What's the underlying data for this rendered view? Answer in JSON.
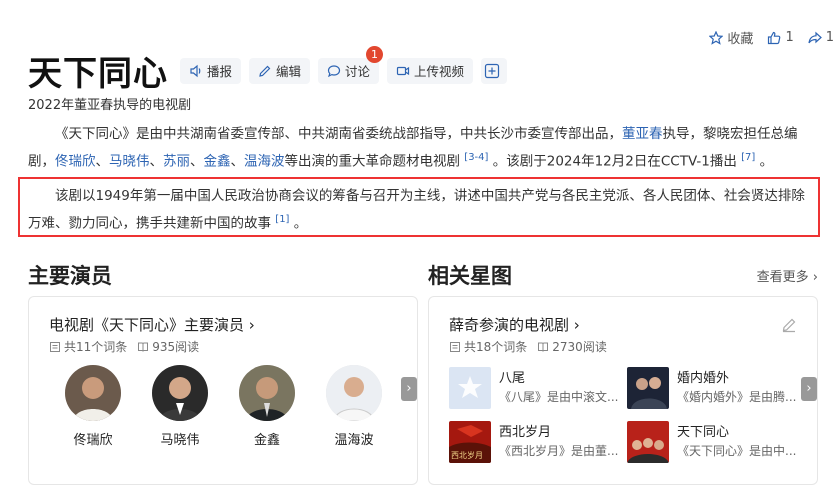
{
  "top_actions": {
    "collect_label": "收藏",
    "like_count": "1",
    "share_count": "1"
  },
  "title": "天下同心",
  "toolbar": {
    "report": "播报",
    "edit": "编辑",
    "discuss": "讨论",
    "discuss_badge": "1",
    "upload": "上传视频",
    "add": "+"
  },
  "subtitle": "2022年董亚春执导的电视剧",
  "para1": {
    "t1": "《天下同心》是由中共湖南省委宣传部、中共湖南省委统战部指导，中共长沙市委宣传部出品，",
    "l1": "董亚春",
    "t2": "执导，黎晓宏担任总编剧，",
    "a1": "佟瑞欣",
    "s1": "、",
    "a2": "马晓伟",
    "s2": "、",
    "a3": "苏丽",
    "s3": "、",
    "a4": "金鑫",
    "s4": "、",
    "a5": "温海波",
    "t3": "等出演的重大革命题材电视剧 ",
    "ref1": "[3-4]",
    "t4": " 。该剧于2024年12月2日在CCTV-1播出 ",
    "ref2": "[7]",
    "t5": " 。"
  },
  "para2": {
    "t1": "该剧以1949年第一届中国人民政治协商会议的筹备与召开为主线，讲述中国共产党与各民主党派、各人民团体、社会贤达排除万难、勠力同心，携手共建新中国的故事 ",
    "ref": "[1]",
    "t2": " 。"
  },
  "cast_section": {
    "title": "主要演员",
    "card_title": "电视剧《天下同心》主要演员 ›",
    "entries": "共11个词条",
    "reads": "935阅读",
    "actors": [
      {
        "name": "佟瑞欣"
      },
      {
        "name": "马晓伟"
      },
      {
        "name": "金鑫"
      },
      {
        "name": "温海波"
      }
    ],
    "next": "›"
  },
  "related_section": {
    "title": "相关星图",
    "more": "查看更多 ›",
    "card_title": "薛奇参演的电视剧 ›",
    "entries": "共18个词条",
    "reads": "2730阅读",
    "dramas": [
      {
        "name": "八尾",
        "desc": "《八尾》是由中滚文..."
      },
      {
        "name": "婚内婚外",
        "desc": "《婚内婚外》是由腾..."
      },
      {
        "name": "西北岁月",
        "desc": "《西北岁月》是由董...",
        "thumb_text": "西北岁月"
      },
      {
        "name": "天下同心",
        "desc": "《天下同心》是由中..."
      }
    ],
    "next": "›"
  }
}
